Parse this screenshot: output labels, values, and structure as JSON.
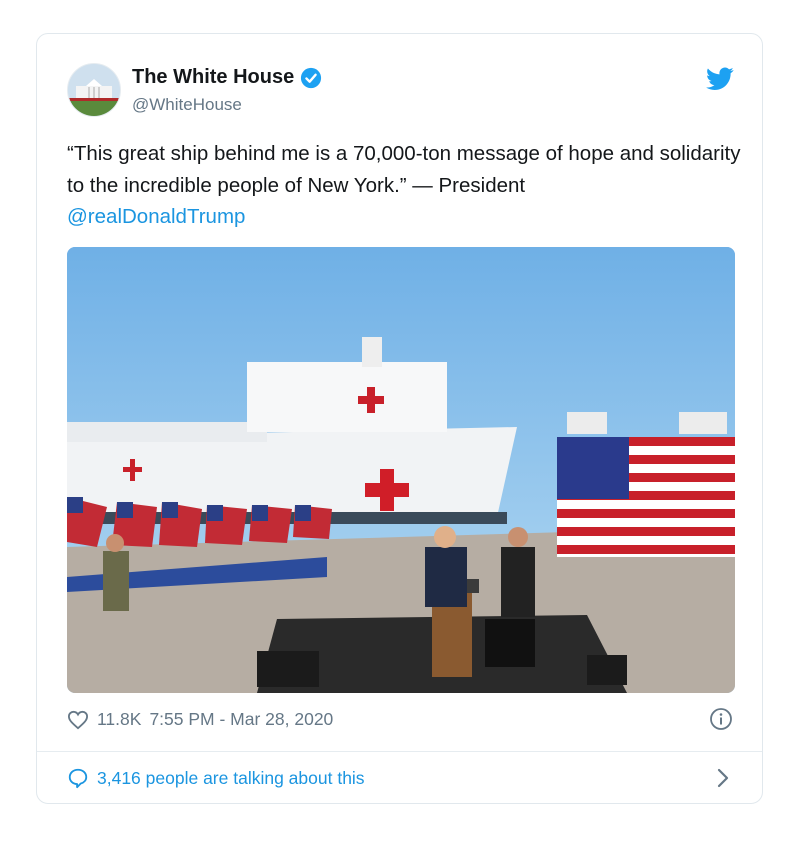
{
  "tweet": {
    "author_name": "The White House",
    "author_handle": "@WhiteHouse",
    "text_body": "“This great ship behind me is a 70,000-ton message of hope and solidarity to the incredible people of New York.” — President",
    "text_mention": "@realDonaldTrump",
    "likes": "11.8K",
    "timestamp": "7:55 PM - Mar 28, 2020",
    "conversation": "3,416 people are talking about this"
  },
  "icons": {
    "verified": "verified-badge-icon",
    "bird": "twitter-bird-icon",
    "heart": "heart-icon",
    "info": "info-icon",
    "bubble": "speech-bubble-icon",
    "chevron": "chevron-right-icon"
  },
  "colors": {
    "accent": "#1da1f2",
    "link": "#1b95e0",
    "muted": "#657786",
    "border": "#e1e8ed"
  }
}
